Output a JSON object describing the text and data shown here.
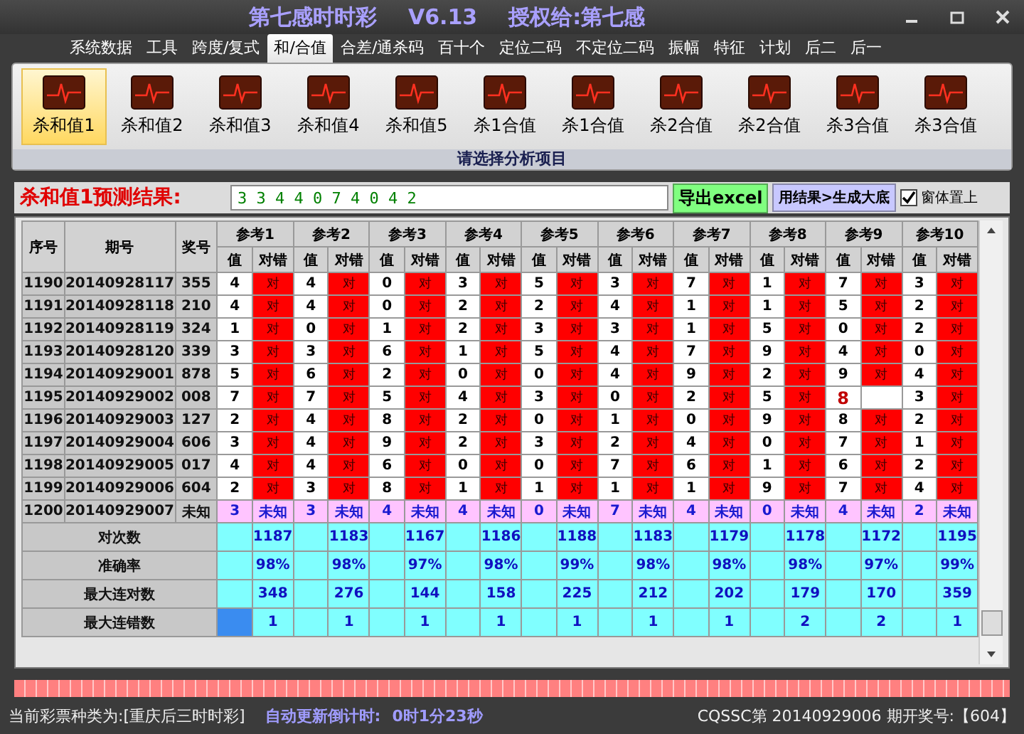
{
  "window": {
    "title_parts": [
      "第七感时时彩",
      "V6.13",
      "授权给:第七感"
    ]
  },
  "tabs": [
    {
      "label": "系统数据",
      "selected": false
    },
    {
      "label": "工具",
      "selected": false
    },
    {
      "label": "跨度/复式",
      "selected": false
    },
    {
      "label": "和/合值",
      "selected": true
    },
    {
      "label": "合差/通杀码",
      "selected": false
    },
    {
      "label": "百十个",
      "selected": false
    },
    {
      "label": "定位二码",
      "selected": false
    },
    {
      "label": "不定位二码",
      "selected": false
    },
    {
      "label": "振幅",
      "selected": false
    },
    {
      "label": "特征",
      "selected": false
    },
    {
      "label": "计划",
      "selected": false
    },
    {
      "label": "后二",
      "selected": false
    },
    {
      "label": "后一",
      "selected": false
    }
  ],
  "toolbar": {
    "items": [
      {
        "label": "杀和值1",
        "selected": true
      },
      {
        "label": "杀和值2",
        "selected": false
      },
      {
        "label": "杀和值3",
        "selected": false
      },
      {
        "label": "杀和值4",
        "selected": false
      },
      {
        "label": "杀和值5",
        "selected": false
      },
      {
        "label": "杀1合值",
        "selected": false
      },
      {
        "label": "杀1合值",
        "selected": false
      },
      {
        "label": "杀2合值",
        "selected": false
      },
      {
        "label": "杀2合值",
        "selected": false
      },
      {
        "label": "杀3合值",
        "selected": false
      },
      {
        "label": "杀3合值",
        "selected": false
      }
    ],
    "caption": "请选择分析项目"
  },
  "result": {
    "label": "杀和值1预测结果:",
    "value": "3 3 4 4 0 7 4 0 4 2",
    "export_button": "导出excel",
    "generate_button": "用结果>生成大底",
    "pin_checkbox": {
      "label": "窗体置上",
      "checked": true
    }
  },
  "table": {
    "columns": [
      "序号",
      "期号",
      "奖号"
    ],
    "groups": [
      {
        "label": "参考1",
        "sub_columns": [
          "值",
          "对错"
        ]
      },
      {
        "label": "参考2",
        "sub_columns": [
          "值",
          "对错"
        ]
      },
      {
        "label": "参考3",
        "sub_columns": [
          "值",
          "对错"
        ]
      },
      {
        "label": "参考4",
        "sub_columns": [
          "值",
          "对错"
        ]
      },
      {
        "label": "参考5",
        "sub_columns": [
          "值",
          "对错"
        ]
      },
      {
        "label": "参考6",
        "sub_columns": [
          "值",
          "对错"
        ]
      },
      {
        "label": "参考7",
        "sub_columns": [
          "值",
          "对错"
        ]
      },
      {
        "label": "参考8",
        "sub_columns": [
          "值",
          "对错"
        ]
      },
      {
        "label": "参考9",
        "sub_columns": [
          "值",
          "对错"
        ]
      },
      {
        "label": "参考10",
        "sub_columns": [
          "值",
          "对错"
        ]
      }
    ],
    "rows": [
      {
        "kind": "past",
        "index": "1190",
        "issue": "20140928117",
        "draw": "355",
        "cells": [
          {
            "value": "4",
            "hit": true,
            "result": "对"
          },
          {
            "value": "4",
            "hit": true,
            "result": "对"
          },
          {
            "value": "0",
            "hit": true,
            "result": "对"
          },
          {
            "value": "3",
            "hit": true,
            "result": "对"
          },
          {
            "value": "5",
            "hit": true,
            "result": "对"
          },
          {
            "value": "3",
            "hit": true,
            "result": "对"
          },
          {
            "value": "7",
            "hit": true,
            "result": "对"
          },
          {
            "value": "1",
            "hit": true,
            "result": "对"
          },
          {
            "value": "7",
            "hit": true,
            "result": "对"
          },
          {
            "value": "3",
            "hit": true,
            "result": "对"
          }
        ]
      },
      {
        "kind": "past",
        "index": "1191",
        "issue": "20140928118",
        "draw": "210",
        "cells": [
          {
            "value": "4",
            "hit": true,
            "result": "对"
          },
          {
            "value": "4",
            "hit": true,
            "result": "对"
          },
          {
            "value": "0",
            "hit": true,
            "result": "对"
          },
          {
            "value": "2",
            "hit": true,
            "result": "对"
          },
          {
            "value": "2",
            "hit": true,
            "result": "对"
          },
          {
            "value": "4",
            "hit": true,
            "result": "对"
          },
          {
            "value": "1",
            "hit": true,
            "result": "对"
          },
          {
            "value": "1",
            "hit": true,
            "result": "对"
          },
          {
            "value": "5",
            "hit": true,
            "result": "对"
          },
          {
            "value": "2",
            "hit": true,
            "result": "对"
          }
        ]
      },
      {
        "kind": "past",
        "index": "1192",
        "issue": "20140928119",
        "draw": "324",
        "cells": [
          {
            "value": "1",
            "hit": true,
            "result": "对"
          },
          {
            "value": "0",
            "hit": true,
            "result": "对"
          },
          {
            "value": "1",
            "hit": true,
            "result": "对"
          },
          {
            "value": "2",
            "hit": true,
            "result": "对"
          },
          {
            "value": "3",
            "hit": true,
            "result": "对"
          },
          {
            "value": "3",
            "hit": true,
            "result": "对"
          },
          {
            "value": "1",
            "hit": true,
            "result": "对"
          },
          {
            "value": "5",
            "hit": true,
            "result": "对"
          },
          {
            "value": "0",
            "hit": true,
            "result": "对"
          },
          {
            "value": "2",
            "hit": true,
            "result": "对"
          }
        ]
      },
      {
        "kind": "past",
        "index": "1193",
        "issue": "20140928120",
        "draw": "339",
        "cells": [
          {
            "value": "3",
            "hit": true,
            "result": "对"
          },
          {
            "value": "3",
            "hit": true,
            "result": "对"
          },
          {
            "value": "6",
            "hit": true,
            "result": "对"
          },
          {
            "value": "1",
            "hit": true,
            "result": "对"
          },
          {
            "value": "5",
            "hit": true,
            "result": "对"
          },
          {
            "value": "4",
            "hit": true,
            "result": "对"
          },
          {
            "value": "7",
            "hit": true,
            "result": "对"
          },
          {
            "value": "9",
            "hit": true,
            "result": "对"
          },
          {
            "value": "4",
            "hit": true,
            "result": "对"
          },
          {
            "value": "0",
            "hit": true,
            "result": "对"
          }
        ]
      },
      {
        "kind": "past",
        "index": "1194",
        "issue": "20140929001",
        "draw": "878",
        "cells": [
          {
            "value": "5",
            "hit": true,
            "result": "对"
          },
          {
            "value": "6",
            "hit": true,
            "result": "对"
          },
          {
            "value": "2",
            "hit": true,
            "result": "对"
          },
          {
            "value": "0",
            "hit": true,
            "result": "对"
          },
          {
            "value": "0",
            "hit": true,
            "result": "对"
          },
          {
            "value": "4",
            "hit": true,
            "result": "对"
          },
          {
            "value": "9",
            "hit": true,
            "result": "对"
          },
          {
            "value": "2",
            "hit": true,
            "result": "对"
          },
          {
            "value": "9",
            "hit": true,
            "result": "对"
          },
          {
            "value": "4",
            "hit": true,
            "result": "对"
          }
        ]
      },
      {
        "kind": "past",
        "index": "1195",
        "issue": "20140929002",
        "draw": "008",
        "cells": [
          {
            "value": "7",
            "hit": true,
            "result": "对"
          },
          {
            "value": "7",
            "hit": true,
            "result": "对"
          },
          {
            "value": "5",
            "hit": true,
            "result": "对"
          },
          {
            "value": "4",
            "hit": true,
            "result": "对"
          },
          {
            "value": "3",
            "hit": true,
            "result": "对"
          },
          {
            "value": "0",
            "hit": true,
            "result": "对"
          },
          {
            "value": "2",
            "hit": true,
            "result": "对"
          },
          {
            "value": "5",
            "hit": true,
            "result": "对"
          },
          {
            "value": "8",
            "hit": false
          },
          {
            "value": "3",
            "hit": true,
            "result": "对"
          }
        ]
      },
      {
        "kind": "past",
        "index": "1196",
        "issue": "20140929003",
        "draw": "127",
        "cells": [
          {
            "value": "2",
            "hit": true,
            "result": "对"
          },
          {
            "value": "4",
            "hit": true,
            "result": "对"
          },
          {
            "value": "8",
            "hit": true,
            "result": "对"
          },
          {
            "value": "2",
            "hit": true,
            "result": "对"
          },
          {
            "value": "0",
            "hit": true,
            "result": "对"
          },
          {
            "value": "1",
            "hit": true,
            "result": "对"
          },
          {
            "value": "0",
            "hit": true,
            "result": "对"
          },
          {
            "value": "9",
            "hit": true,
            "result": "对"
          },
          {
            "value": "8",
            "hit": true,
            "result": "对"
          },
          {
            "value": "2",
            "hit": true,
            "result": "对"
          }
        ]
      },
      {
        "kind": "past",
        "index": "1197",
        "issue": "20140929004",
        "draw": "606",
        "cells": [
          {
            "value": "3",
            "hit": true,
            "result": "对"
          },
          {
            "value": "4",
            "hit": true,
            "result": "对"
          },
          {
            "value": "9",
            "hit": true,
            "result": "对"
          },
          {
            "value": "2",
            "hit": true,
            "result": "对"
          },
          {
            "value": "3",
            "hit": true,
            "result": "对"
          },
          {
            "value": "2",
            "hit": true,
            "result": "对"
          },
          {
            "value": "4",
            "hit": true,
            "result": "对"
          },
          {
            "value": "0",
            "hit": true,
            "result": "对"
          },
          {
            "value": "7",
            "hit": true,
            "result": "对"
          },
          {
            "value": "1",
            "hit": true,
            "result": "对"
          }
        ]
      },
      {
        "kind": "past",
        "index": "1198",
        "issue": "20140929005",
        "draw": "017",
        "cells": [
          {
            "value": "4",
            "hit": true,
            "result": "对"
          },
          {
            "value": "4",
            "hit": true,
            "result": "对"
          },
          {
            "value": "6",
            "hit": true,
            "result": "对"
          },
          {
            "value": "0",
            "hit": true,
            "result": "对"
          },
          {
            "value": "0",
            "hit": true,
            "result": "对"
          },
          {
            "value": "7",
            "hit": true,
            "result": "对"
          },
          {
            "value": "6",
            "hit": true,
            "result": "对"
          },
          {
            "value": "1",
            "hit": true,
            "result": "对"
          },
          {
            "value": "6",
            "hit": true,
            "result": "对"
          },
          {
            "value": "2",
            "hit": true,
            "result": "对"
          }
        ]
      },
      {
        "kind": "past",
        "index": "1199",
        "issue": "20140929006",
        "draw": "604",
        "cells": [
          {
            "value": "2",
            "hit": true,
            "result": "对"
          },
          {
            "value": "3",
            "hit": true,
            "result": "对"
          },
          {
            "value": "8",
            "hit": true,
            "result": "对"
          },
          {
            "value": "1",
            "hit": true,
            "result": "对"
          },
          {
            "value": "1",
            "hit": true,
            "result": "对"
          },
          {
            "value": "1",
            "hit": true,
            "result": "对"
          },
          {
            "value": "1",
            "hit": true,
            "result": "对"
          },
          {
            "value": "9",
            "hit": true,
            "result": "对"
          },
          {
            "value": "7",
            "hit": true,
            "result": "对"
          },
          {
            "value": "4",
            "hit": true,
            "result": "对"
          }
        ]
      },
      {
        "kind": "pending",
        "index": "1200",
        "issue": "20140929007",
        "draw": "未知",
        "cells": [
          {
            "value": "3",
            "result": "未知"
          },
          {
            "value": "3",
            "result": "未知"
          },
          {
            "value": "4",
            "result": "未知"
          },
          {
            "value": "4",
            "result": "未知"
          },
          {
            "value": "0",
            "result": "未知"
          },
          {
            "value": "7",
            "result": "未知"
          },
          {
            "value": "4",
            "result": "未知"
          },
          {
            "value": "0",
            "result": "未知"
          },
          {
            "value": "4",
            "result": "未知"
          },
          {
            "value": "2",
            "result": "未知"
          }
        ]
      }
    ],
    "summary": [
      {
        "label": "对次数",
        "selected": false,
        "values": [
          "1187",
          "1183",
          "1167",
          "1186",
          "1188",
          "1183",
          "1179",
          "1178",
          "1172",
          "1195"
        ]
      },
      {
        "label": "准确率",
        "selected": false,
        "values": [
          "98%",
          "98%",
          "97%",
          "98%",
          "99%",
          "98%",
          "98%",
          "98%",
          "97%",
          "99%"
        ]
      },
      {
        "label": "最大连对数",
        "selected": false,
        "values": [
          "348",
          "276",
          "144",
          "158",
          "225",
          "212",
          "202",
          "179",
          "170",
          "359"
        ]
      },
      {
        "label": "最大连错数",
        "selected": true,
        "values": [
          "1",
          "1",
          "1",
          "1",
          "1",
          "1",
          "1",
          "2",
          "2",
          "1"
        ]
      }
    ]
  },
  "progress": {
    "level": 1
  },
  "status_bar": {
    "lottery": "当前彩票种类为:[重庆后三时时彩]",
    "countdown_label": "自动更新倒计时:",
    "countdown": "0时1分23秒",
    "latest": "CQSSC第 20140929006 期开奖号:【604】"
  }
}
